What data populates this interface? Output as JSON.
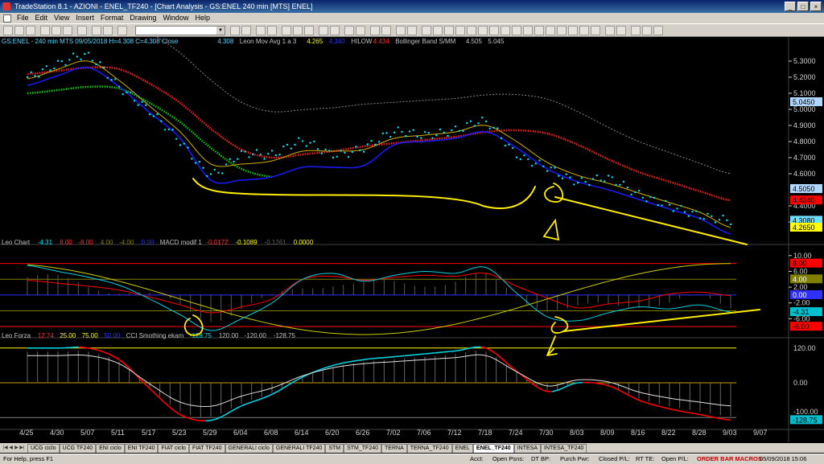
{
  "window": {
    "title": "TradeStation 8.1 - AZIONI - ENEL_TF240 - [Chart Analysis - GS:ENEL  240 min  [MTS] ENEL]",
    "controls": [
      "_",
      "□",
      "×"
    ]
  },
  "menu": [
    "File",
    "Edit",
    "View",
    "Insert",
    "Format",
    "Drawing",
    "Window",
    "Help"
  ],
  "toolbar": {
    "symbol_value": "",
    "dropdown_arrow": "▼"
  },
  "colors": {
    "background": "#000000",
    "price_dots": "#00e5ff",
    "mov_avg_fast": "#d4b000",
    "mov_avg_blue": "#1a1aff",
    "hilow_red": "#ff1a1a",
    "bollinger_green": "#00cc00",
    "trendline": "#ffee00",
    "cci_red": "#ff0000",
    "cci_cyan": "#00d0e0"
  },
  "panel1": {
    "legend": [
      {
        "text": "GS:ENEL - 240 min   MTS   09/05/2018  H=4.308  C=4.308  Close",
        "color": "#5ad7ff"
      },
      {
        "text": "4.308",
        "color": "#5ad7ff"
      },
      {
        "text": "Leon Mov Avg 1 a 3",
        "color": "#c0c0c0"
      },
      {
        "text": "4.265",
        "color": "#ffff00"
      },
      {
        "text": "4.340",
        "color": "#3030ff"
      },
      {
        "text": "HILOW",
        "color": "#c0c0c0"
      },
      {
        "text": "4.434",
        "color": "#ff3030"
      },
      {
        "text": "Bollinger Band S/MM",
        "color": "#c0c0c0"
      },
      {
        "text": "4.505",
        "color": "#c0c0c0"
      },
      {
        "text": "5.045",
        "color": "#c0c0c0"
      }
    ],
    "axis_ticks": [
      "5.3000",
      "5.2000",
      "5.1000",
      "5.0000",
      "4.9000",
      "4.8000",
      "4.7000",
      "4.6000",
      "4.4000",
      "4.3000"
    ],
    "price_labels": [
      {
        "text": "5.0450",
        "bg": "#b0d8ff",
        "fg": "#000000"
      },
      {
        "text": "4.5050",
        "bg": "#b0d8ff",
        "fg": "#000000"
      },
      {
        "text": "4.4340",
        "bg": "#ff0000",
        "fg": "#000000"
      },
      {
        "text": "4.3080",
        "bg": "#6ee0ff",
        "fg": "#000000"
      },
      {
        "text": "4.2650",
        "bg": "#ffff00",
        "fg": "#000000"
      }
    ]
  },
  "panel2": {
    "legend": [
      {
        "text": "Leo Chart",
        "color": "#c0c0c0"
      },
      {
        "text": "-4.31",
        "color": "#00e5ff"
      },
      {
        "text": "8.00",
        "color": "#ff3030"
      },
      {
        "text": "-8.00",
        "color": "#ff3030"
      },
      {
        "text": "4.00",
        "color": "#808000"
      },
      {
        "text": "-4.00",
        "color": "#808000"
      },
      {
        "text": "0.00",
        "color": "#3030ff"
      },
      {
        "text": "MACD modif 1",
        "color": "#c0c0c0"
      },
      {
        "text": "-0.0172",
        "color": "#ff3030"
      },
      {
        "text": "-0.1089",
        "color": "#ffff00"
      },
      {
        "text": "-0.1261",
        "color": "#606060"
      },
      {
        "text": "0.0000",
        "color": "#ffff00"
      }
    ],
    "axis_ticks": [
      "10.00",
      "6.00",
      "2.00",
      "-2.00",
      "-6.00"
    ],
    "value_labels": [
      {
        "text": "8.00",
        "bg": "#ff0000",
        "fg": "#000000"
      },
      {
        "text": "4.00",
        "bg": "#808000",
        "fg": "#ffffff"
      },
      {
        "text": "0.00",
        "bg": "#3030ff",
        "fg": "#ffffff"
      },
      {
        "text": "-4.31",
        "bg": "#00c0d0",
        "fg": "#000000"
      },
      {
        "text": "-8.00",
        "bg": "#ff0000",
        "fg": "#000000"
      }
    ]
  },
  "panel3": {
    "legend": [
      {
        "text": "Leo Forza",
        "color": "#c0c0c0"
      },
      {
        "text": "12.74",
        "color": "#ff3030"
      },
      {
        "text": "25.00",
        "color": "#ffff00"
      },
      {
        "text": "75.00",
        "color": "#ffff00"
      },
      {
        "text": "50.00",
        "color": "#3030ff"
      },
      {
        "text": "CCI Smothing ekam",
        "color": "#c0c0c0"
      },
      {
        "text": "-128.75",
        "color": "#00e5ff"
      },
      {
        "text": "120.00",
        "color": "#c0c0c0"
      },
      {
        "text": "-120.00",
        "color": "#c0c0c0"
      },
      {
        "text": "-128.75",
        "color": "#c0c0c0"
      }
    ],
    "axis_ticks": [
      "120.00",
      "0.00",
      "-100.00"
    ],
    "value_labels": [
      {
        "text": "-128.75",
        "bg": "#00c0d0",
        "fg": "#000000"
      }
    ]
  },
  "date_axis": [
    "4/25",
    "4/30",
    "5/07",
    "5/11",
    "5/17",
    "5/23",
    "5/29",
    "6/04",
    "6/08",
    "6/14",
    "6/20",
    "6/26",
    "7/02",
    "7/06",
    "7/12",
    "7/18",
    "7/24",
    "7/30",
    "8/03",
    "8/09",
    "8/16",
    "8/22",
    "8/28",
    "9/03",
    "9/07"
  ],
  "tabs": [
    "UCG ciclo",
    "UCG TF240",
    "ENI ciclo",
    "ENI TF240",
    "FIAT ciclo",
    "FIAT TF240",
    "GENERALI ciclo",
    "GENERALI TF240",
    "STM",
    "STM_TF240",
    "TERNA",
    "TERNA_TF240",
    "ENEL",
    "ENEL_TF240",
    "INTESA",
    "INTESA_TF240"
  ],
  "active_tab": "ENEL_TF240",
  "status": {
    "help": "For Help, press F1",
    "acct": "Acct:",
    "open_psns": "Open Psns:",
    "dt_bp": "DT BP:",
    "purch_pwr": "Purch Pwr:",
    "closed_pl": "Closed P/L:",
    "rt_te": "RT TE:",
    "open_pl": "Open P/L:",
    "order_bar": "ORDER BAR  MACROS",
    "datetime": "05/09/2018 15:06"
  },
  "chart_data": [
    {
      "type": "line",
      "title": "GS:ENEL - 240 min",
      "ylim": [
        4.2,
        5.4
      ],
      "categories": [
        "4/25",
        "4/30",
        "5/07",
        "5/11",
        "5/17",
        "5/23",
        "5/29",
        "6/04",
        "6/08",
        "6/14",
        "6/20",
        "6/26",
        "7/02",
        "7/06",
        "7/12",
        "7/18",
        "7/24",
        "7/30",
        "8/03",
        "8/09",
        "8/16",
        "8/22",
        "8/28",
        "9/03"
      ],
      "series": [
        {
          "name": "Close",
          "values": [
            5.2,
            5.28,
            5.33,
            5.14,
            4.99,
            4.8,
            4.6,
            4.72,
            4.72,
            4.8,
            4.72,
            4.76,
            4.86,
            4.84,
            4.87,
            4.92,
            4.72,
            4.64,
            4.55,
            4.57,
            4.47,
            4.4,
            4.34,
            4.31
          ]
        },
        {
          "name": "Leon Mov Avg 1 a 3",
          "values": [
            5.19,
            5.25,
            5.3,
            5.18,
            5.02,
            4.86,
            4.66,
            4.66,
            4.68,
            4.74,
            4.74,
            4.75,
            4.82,
            4.84,
            4.86,
            4.9,
            4.8,
            4.67,
            4.59,
            4.54,
            4.48,
            4.42,
            4.36,
            4.265
          ]
        },
        {
          "name": "HILOW",
          "values": [
            5.22,
            5.24,
            5.26,
            5.25,
            5.16,
            5.04,
            4.88,
            4.75,
            4.7,
            4.72,
            4.74,
            4.77,
            4.79,
            4.81,
            4.83,
            4.86,
            4.87,
            4.85,
            4.78,
            4.69,
            4.61,
            4.55,
            4.49,
            4.434
          ]
        }
      ]
    },
    {
      "type": "line",
      "title": "MACD modif 1",
      "ylim": [
        -10,
        12
      ],
      "series": [
        {
          "name": "MACD",
          "values": [
            7.5,
            6.0,
            4.5,
            2.5,
            -1.0,
            -5.0,
            -9.0,
            -6.0,
            -2.0,
            4.0,
            5.5,
            3.5,
            5.0,
            6.0,
            5.5,
            7.0,
            0.5,
            -5.5,
            -6.5,
            -4.5,
            -3.0,
            -3.5,
            -2.5,
            -4.31
          ]
        }
      ]
    },
    {
      "type": "line",
      "title": "CCI Smothing ekam",
      "ylim": [
        -150,
        150
      ],
      "series": [
        {
          "name": "CCI",
          "values": [
            120,
            120,
            120,
            80,
            -20,
            -110,
            -130,
            -80,
            -40,
            20,
            60,
            80,
            90,
            100,
            110,
            120,
            40,
            -30,
            0,
            -10,
            -60,
            -90,
            -110,
            -128.75
          ]
        }
      ]
    }
  ]
}
